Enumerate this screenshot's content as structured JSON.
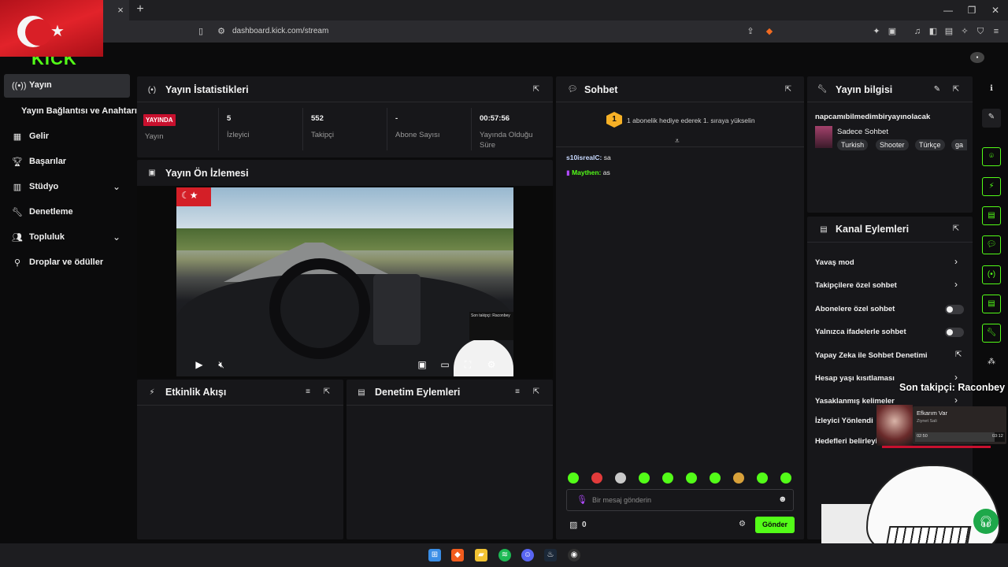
{
  "browser": {
    "url": "dashboard.kick.com/stream",
    "tab_close": "×",
    "new_tab": "+"
  },
  "sidebar": {
    "items": [
      {
        "label": "Yayın",
        "icon": "broadcast-icon"
      },
      {
        "label": "Yayın Bağlantısı ve Anahtarı"
      },
      {
        "label": "Gelir",
        "icon": "revenue-icon"
      },
      {
        "label": "Başarılar",
        "icon": "trophy-icon"
      },
      {
        "label": "Stüdyo",
        "icon": "studio-icon"
      },
      {
        "label": "Denetleme",
        "icon": "wrench-icon"
      },
      {
        "label": "Topluluk",
        "icon": "community-icon"
      },
      {
        "label": "Droplar ve ödüller",
        "icon": "drops-icon"
      }
    ]
  },
  "stats": {
    "title": "Yayın İstatistikleri",
    "live_badge": "YAYINDA",
    "cells": [
      {
        "value": "",
        "label": "Yayın"
      },
      {
        "value": "5",
        "label": "İzleyici"
      },
      {
        "value": "552",
        "label": "Takipçi"
      },
      {
        "value": "-",
        "label": "Abone Sayısı"
      },
      {
        "value": "00:57:56",
        "label": "Yayında Olduğu Süre"
      }
    ]
  },
  "preview": {
    "title": "Yayın Ön İzlemesi",
    "overlay_note": "Son takipçi: Raconbey"
  },
  "activity": {
    "title": "Etkinlik Akışı"
  },
  "moderation": {
    "title": "Denetim Eylemleri"
  },
  "chat": {
    "title": "Sohbet",
    "promo_rank": "1",
    "promo_text": "1 abonelik hediye ederek 1. sıraya yükselin",
    "messages": [
      {
        "user": "s10isrealC:",
        "text": "sa"
      },
      {
        "user": "Maythen:",
        "text": "as"
      }
    ],
    "placeholder": "Bir mesaj gönderin",
    "points": "0",
    "send_label": "Gönder"
  },
  "stream_info": {
    "title": "Yayın bilgisi",
    "stream_title": "napcamıbilmedimbiryayınolacak",
    "category": "Sadece Sohbet",
    "tags": [
      "Turkish",
      "Shooter",
      "Türkçe",
      "ga"
    ]
  },
  "channel_actions": {
    "title": "Kanal Eylemleri",
    "items": [
      {
        "label": "Yavaş mod",
        "control": "chevron"
      },
      {
        "label": "Takipçilere özel sohbet",
        "control": "chevron"
      },
      {
        "label": "Abonelere özel sohbet",
        "control": "toggle",
        "on": false
      },
      {
        "label": "Yalnızca ifadelerle sohbet",
        "control": "toggle",
        "on": false
      },
      {
        "label": "Yapay Zeka ile Sohbet Denetimi",
        "control": "external"
      },
      {
        "label": "Hesap yaşı kısıtlaması",
        "control": "chevron"
      },
      {
        "label": "Yasaklanmış kelimeler",
        "control": "chevron"
      },
      {
        "label": "İzleyici Yönlendi",
        "control": "chevron"
      },
      {
        "label": "Hedefleri belirleyin",
        "control": "chevron"
      }
    ]
  },
  "overlay": {
    "follower_banner": "Son takipçi: Raconbey",
    "music_title": "Efkarım Var",
    "music_artist": "Ziynet Sali",
    "music_elapsed": "02:50",
    "music_total": "03:12",
    "music_progress": 0.89
  },
  "colors": {
    "accent": "#53fc18",
    "live": "#c8102e",
    "panel": "#17171a",
    "background": "#0b0b0c"
  }
}
